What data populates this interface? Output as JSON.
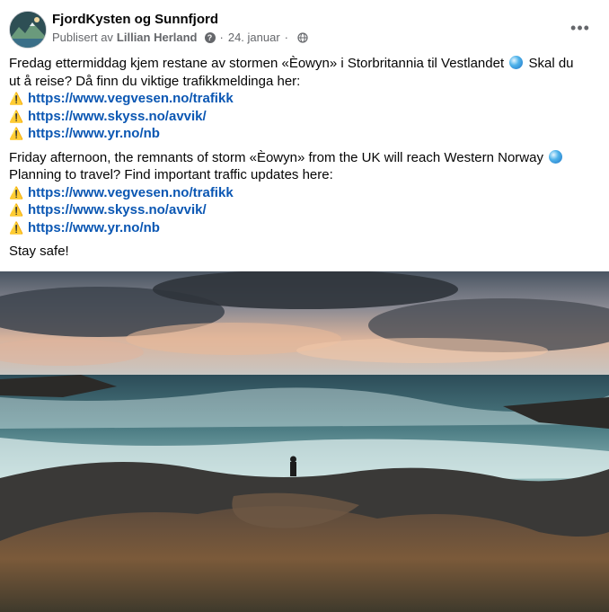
{
  "post": {
    "page_name": "FjordKysten og Sunnfjord",
    "published_by_label": "Publisert av",
    "author": "Lillian Herland",
    "date": "24. januar",
    "separator": "·",
    "more_icon": "more-horizontal-icon",
    "audience_icon": "globe-icon"
  },
  "text": {
    "no_line1": "Fredag ettermiddag kjem restane av stormen «Èowyn» i Storbritannia til Vestlandet",
    "no_line1b": "Skal du",
    "no_line2": "ut å reise? Då finn du viktige trafikkmeldinga her:",
    "en_line1": "Friday afternoon, the remnants of storm «Èowyn» from the UK will reach Western Norway",
    "en_line2": "Planning to travel? Find important traffic updates here:",
    "closing": "Stay safe!",
    "warn_glyph": "⚠️"
  },
  "links_no": [
    "https://www.vegvesen.no/trafikk",
    "https://www.skyss.no/avvik/",
    "https://www.yr.no/nb"
  ],
  "links_en": [
    "https://www.vegvesen.no/trafikk",
    "https://www.skyss.no/avvik/",
    "https://www.yr.no/nb"
  ],
  "colors": {
    "link": "#0b57b3",
    "meta": "#65676b",
    "text": "#050505"
  }
}
